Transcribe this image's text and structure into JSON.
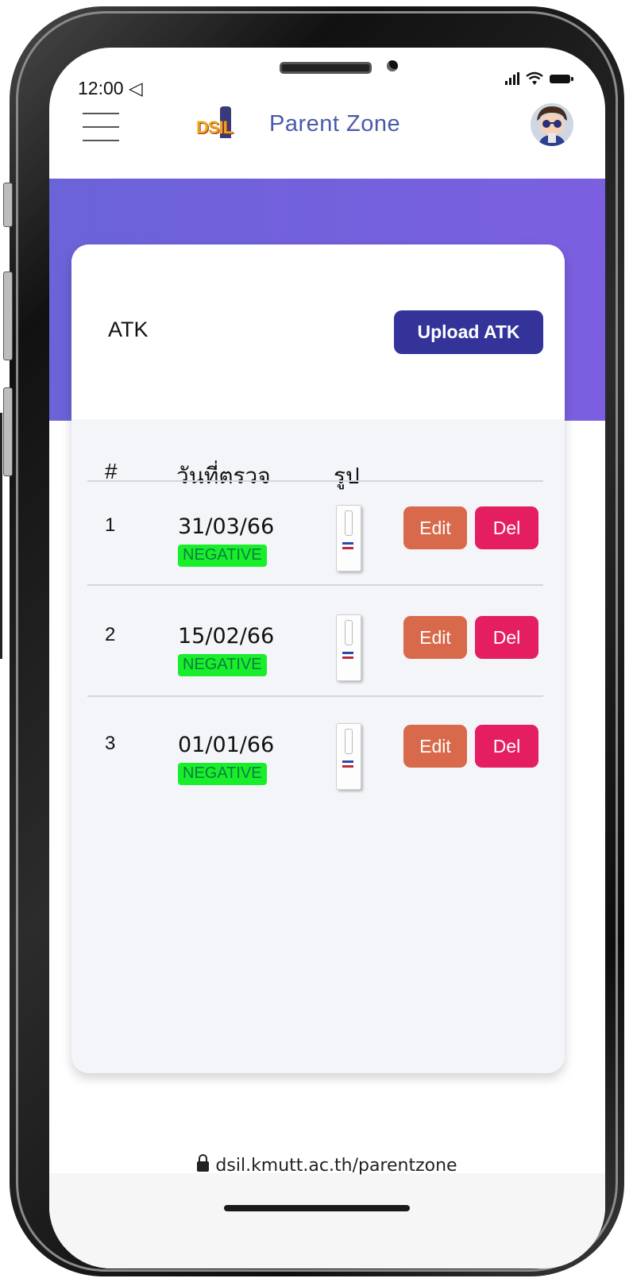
{
  "status_bar": {
    "time": "12:00 ◁"
  },
  "header": {
    "logo_text": "DSIL",
    "title": "Parent Zone"
  },
  "card": {
    "title": "ATK",
    "upload_label": "Upload ATK",
    "columns": [
      "#",
      "วันที่ตรวจ",
      "รูป"
    ],
    "rows": [
      {
        "num": "1",
        "date": "31/03/66",
        "status": "NEGATIVE",
        "edit": "Edit",
        "del": "Del"
      },
      {
        "num": "2",
        "date": "15/02/66",
        "status": "NEGATIVE",
        "edit": "Edit",
        "del": "Del"
      },
      {
        "num": "3",
        "date": "01/01/66",
        "status": "NEGATIVE",
        "edit": "Edit",
        "del": "Del"
      }
    ]
  },
  "footer": {
    "url": "dsil.kmutt.ac.th/parentzone"
  },
  "colors": {
    "header_gradient": [
      "#6b63d8",
      "#7b5fe0"
    ],
    "upload_button": "#33339a",
    "edit_button": "#d9694b",
    "delete_button": "#e41e60",
    "negative_badge": "#19ee2a"
  }
}
